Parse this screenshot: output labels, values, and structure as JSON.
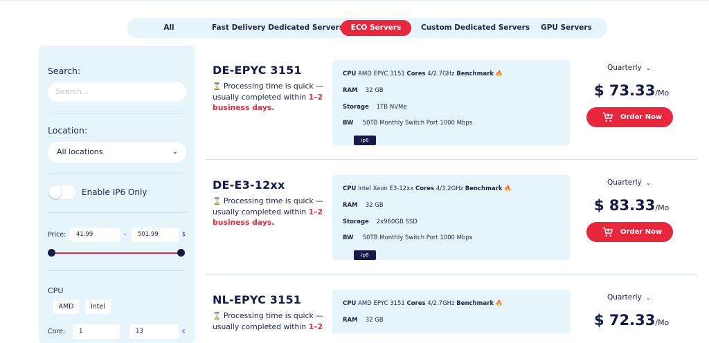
{
  "tabs": [
    {
      "label": "All"
    },
    {
      "label": "Fast Delivery Dedicated Servers"
    },
    {
      "label": "ECO Servers",
      "active": true
    },
    {
      "label": "Custom Dedicated Servers"
    },
    {
      "label": "GPU Servers"
    }
  ],
  "sidebar": {
    "search_label": "Search:",
    "search_placeholder": "Search...",
    "location_label": "Location:",
    "location_value": "All locations",
    "ip6_label": "Enable IP6 Only",
    "price_label": "Price:",
    "price_min": "41.99",
    "price_sep": "-",
    "price_max": "501.99",
    "price_unit": "$",
    "cpu_label": "CPU",
    "cpu_options": [
      "AMD",
      "Intel"
    ],
    "core_label": "Core:",
    "core_min": "1",
    "core_max": "13",
    "core_unit": "c"
  },
  "servers": [
    {
      "name": "DE-EPYC 3151",
      "proc_text": "Processing time is quick — usually completed within ",
      "proc_highlight": "1–2 business days.",
      "cpu_label": "CPU",
      "cpu_value": "AMD EPYC 3151",
      "cores_label": "Cores",
      "cores_value": "4/2.7GHz",
      "bench_label": "Benchmark",
      "ram_label": "RAM",
      "ram_value": "32 GB",
      "storage_label": "Storage",
      "storage_value": "1TB NVMe",
      "bw_label": "BW",
      "bw_value": "50TB Monthly Switch Port 1000 Mbps",
      "badge": "ip6",
      "billing": "Quarterly",
      "price": "$ 73.33",
      "price_unit": "/Mo",
      "order_label": "Order Now"
    },
    {
      "name": "DE-E3-12xx",
      "proc_text": "Processing time is quick — usually completed within ",
      "proc_highlight": "1–2 business days.",
      "cpu_label": "CPU",
      "cpu_value": "Intel Xeon E3-12xx",
      "cores_label": "Cores",
      "cores_value": "4/3.2GHz",
      "bench_label": "Benchmark",
      "ram_label": "RAM",
      "ram_value": "32 GB",
      "storage_label": "Storage",
      "storage_value": "2x960GB SSD",
      "bw_label": "BW",
      "bw_value": "50TB Monthly Switch Port 1000 Mbps",
      "badge": "ip6",
      "billing": "Quarterly",
      "price": "$ 83.33",
      "price_unit": "/Mo",
      "order_label": "Order Now"
    },
    {
      "name": "NL-EPYC 3151",
      "proc_text": "Processing time is quick — usually completed within ",
      "proc_highlight": "1–2",
      "cpu_label": "CPU",
      "cpu_value": "AMD EPYC 3151",
      "cores_label": "Cores",
      "cores_value": "4/2.7GHz",
      "bench_label": "Benchmark",
      "ram_label": "RAM",
      "ram_value": "32 GB",
      "billing": "Quarterly",
      "price": "$ 72.33",
      "price_unit": "/Mo"
    }
  ],
  "colors": {
    "accent": "#e8273c",
    "navy": "#151a4a",
    "panel": "#e6f4fb"
  },
  "icons": [
    "hourglass-icon",
    "fire-icon",
    "cart-icon",
    "chevron-down-icon"
  ]
}
